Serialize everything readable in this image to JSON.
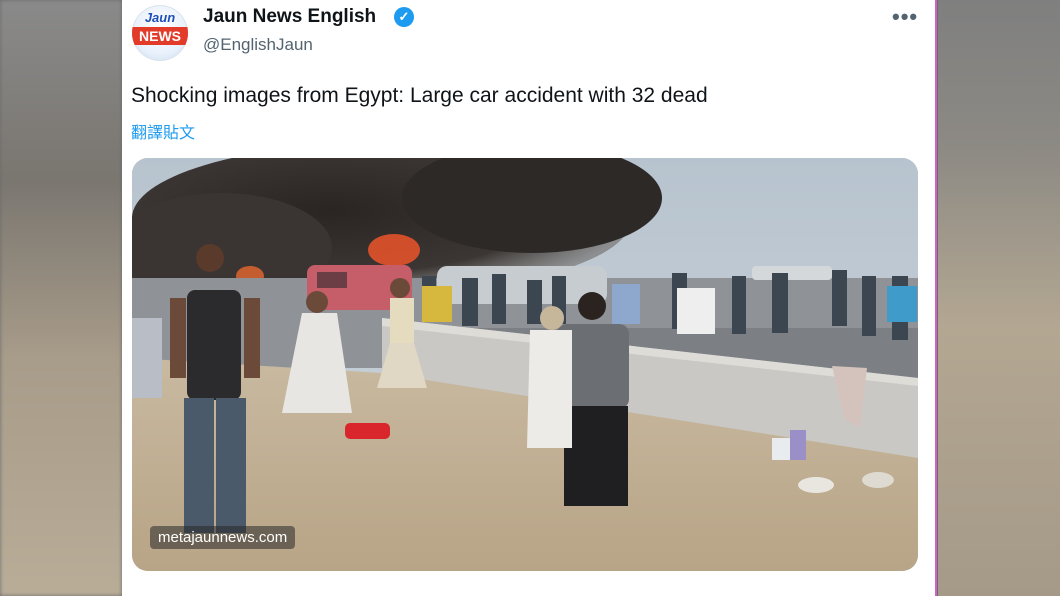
{
  "tweet": {
    "author_name": "Jaun News English",
    "handle": "@EnglishJaun",
    "avatar_top": "Jaun",
    "avatar_bar": "NEWS",
    "verified_mark": "✓",
    "more_label": "•••",
    "text": "Shocking images from Egypt: Large car accident with 32 dead",
    "translate_label": "翻譯貼文",
    "media_watermark": "metajaunnews.com"
  },
  "colors": {
    "verified": "#1d9bf0",
    "link": "#1d9bf0",
    "text": "#0f1419",
    "secondary": "#536471",
    "brand_red": "#e23b2a",
    "brand_blue": "#1e4fb8"
  },
  "icons": {
    "verified": "verified-badge-icon",
    "more": "more-options-icon"
  }
}
